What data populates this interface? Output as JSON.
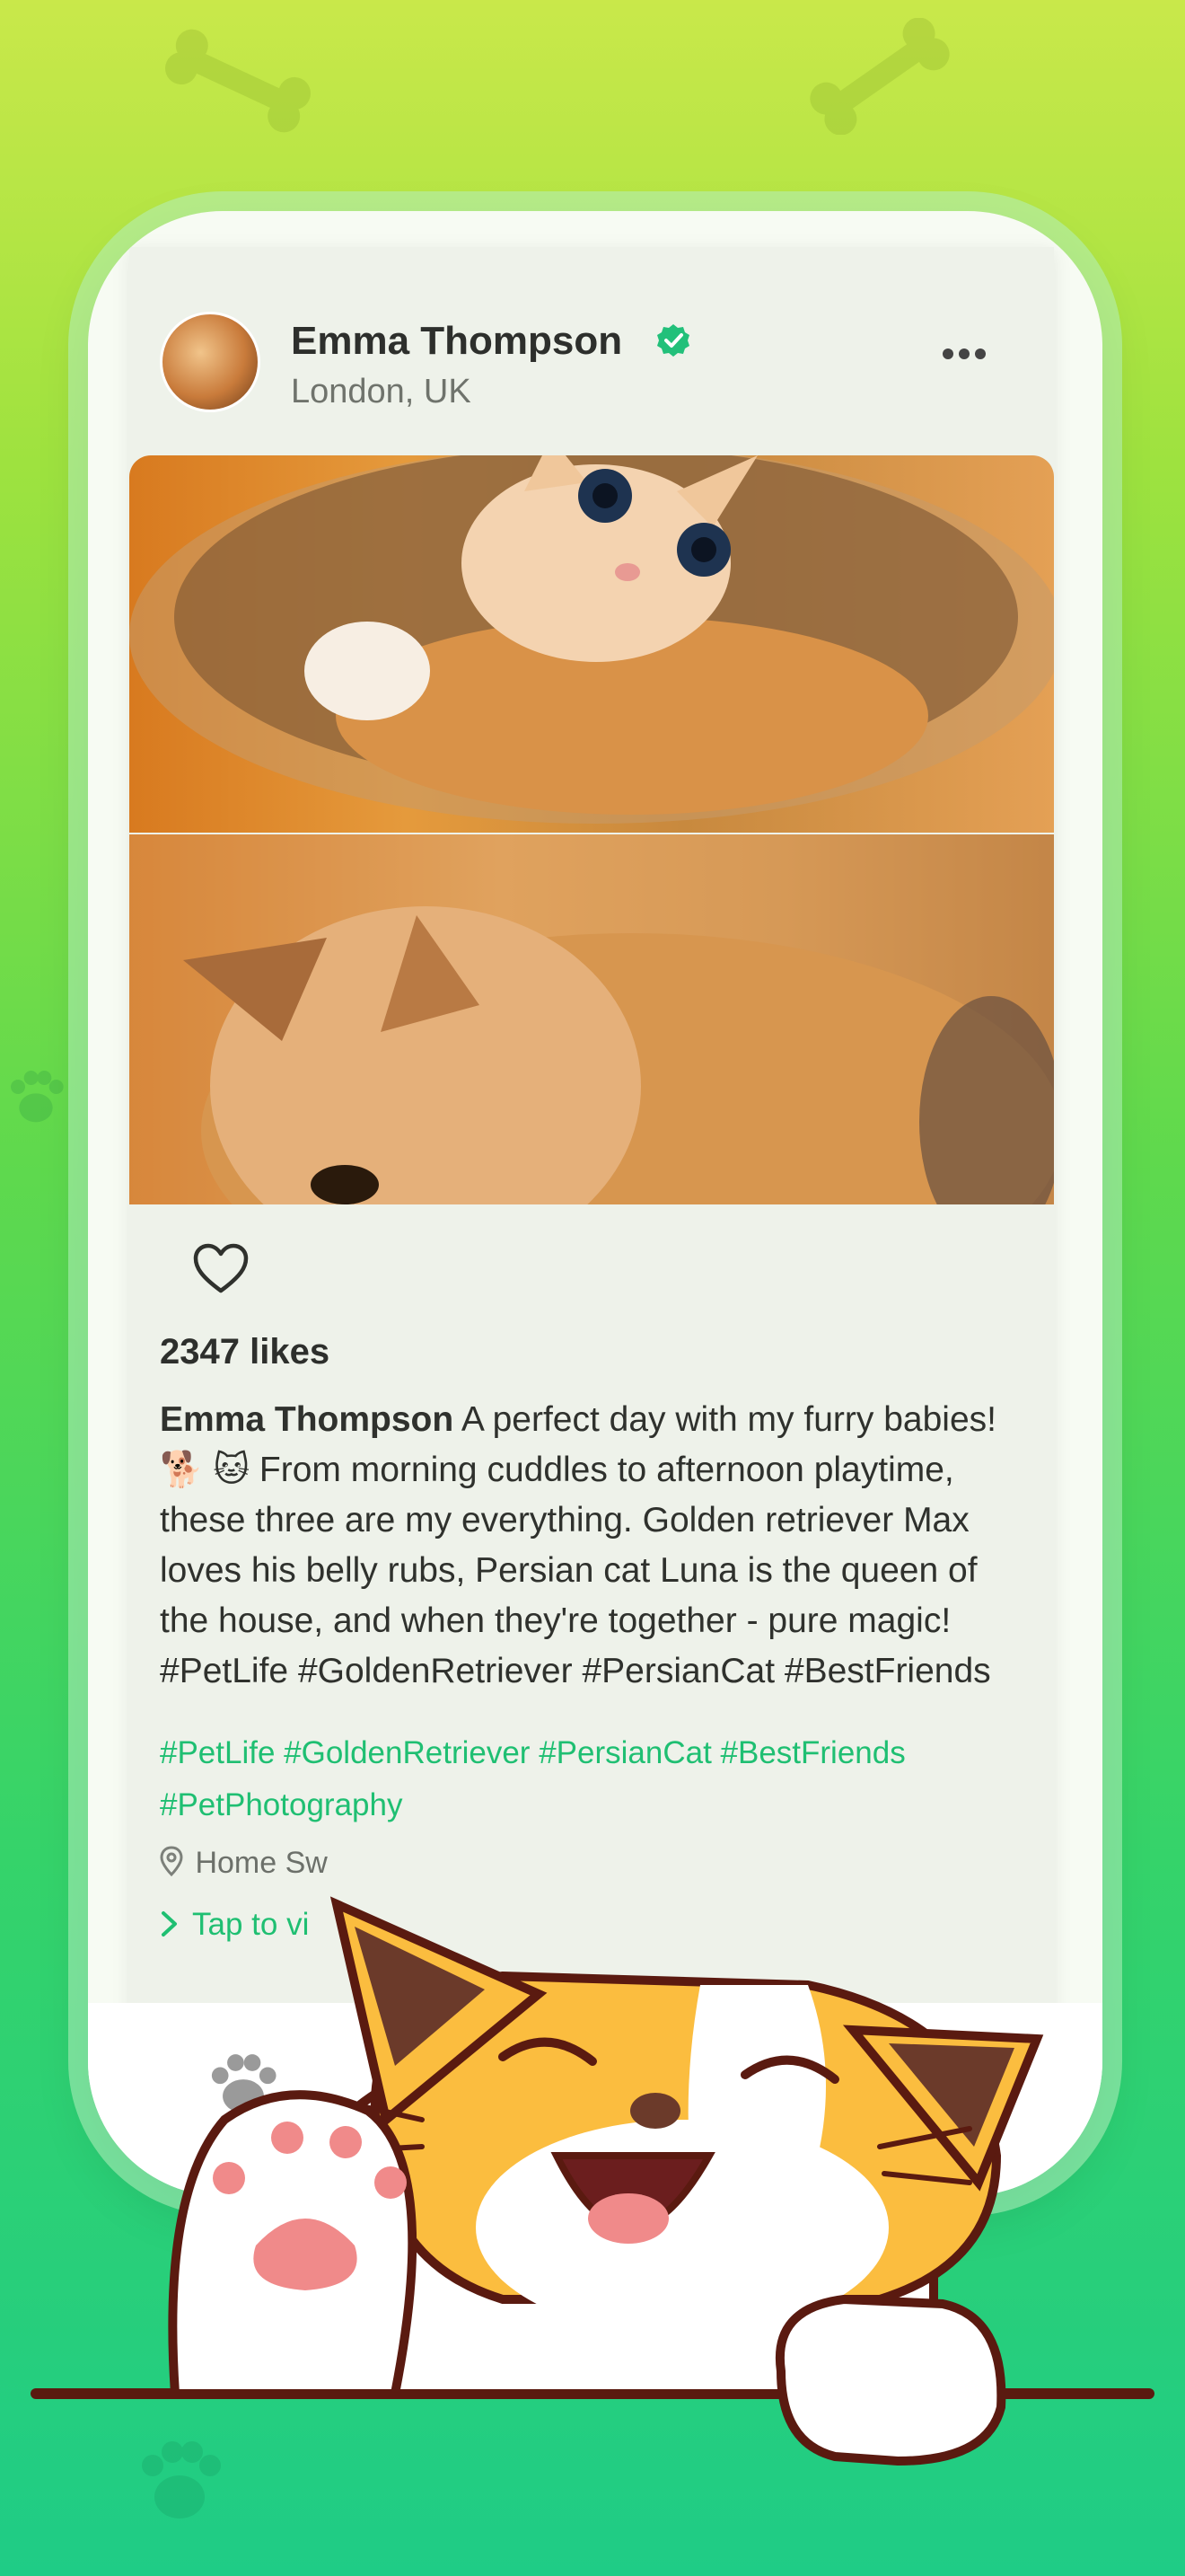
{
  "post": {
    "author": "Emma Thompson",
    "location": "London, UK",
    "likes": "2347 likes",
    "caption_author": "Emma Thompson",
    "caption_text": " A perfect day with my furry babies! 🐕 🐱  From morning cuddles to afternoon playtime, these three are my everything. Golden retriever Max loves his belly rubs, Persian cat Luna is the queen of the house, and when they're together - pure magic! #PetLife #GoldenRetriever #PersianCat #BestFriends",
    "hashtags": "#PetLife #GoldenRetriever #PersianCat #BestFriends #PetPhotography",
    "place_label": "Home Sw",
    "view_link": "Tap to vi"
  },
  "icons": {
    "verified": "verified-check-icon",
    "more": "more-dots-icon",
    "like": "heart-icon",
    "pin": "location-pin-icon",
    "chevron": "chevron-right-icon",
    "tab_home": "paw-icon"
  },
  "colors": {
    "accent": "#1fbf72",
    "verified": "#22c07a",
    "text_primary": "#2d2f2c"
  }
}
